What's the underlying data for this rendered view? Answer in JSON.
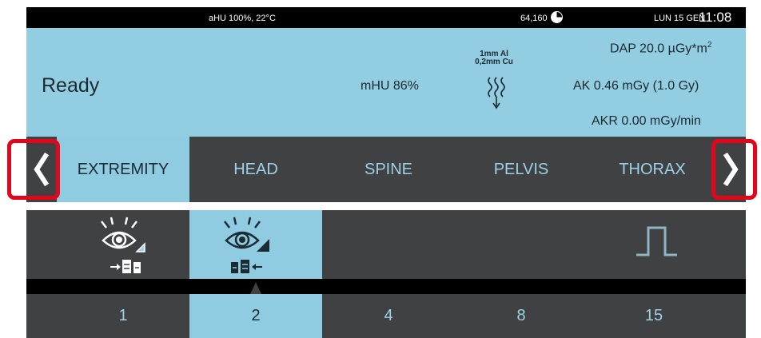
{
  "status_bar": {
    "environment": "aHU 100%, 22°C",
    "counter": "64,160",
    "date": "LUN 15 GEN",
    "time": "11:08"
  },
  "exposure_panel": {
    "status": "Ready",
    "tube_heat": "mHU 86%",
    "filter_line1": "1mm Al",
    "filter_line2": "0,2mm Cu",
    "dap_text": "DAP 20.0 µGy*m",
    "dap_exponent": "2",
    "ak": "AK 0.46 mGy  (1.0 Gy)",
    "akr": "AKR  0.00 mGy/min"
  },
  "regions": {
    "items": [
      {
        "label": "EXTREMITY",
        "selected": true
      },
      {
        "label": "HEAD",
        "selected": false
      },
      {
        "label": "SPINE",
        "selected": false
      },
      {
        "label": "PELVIS",
        "selected": false
      },
      {
        "label": "THORAX",
        "selected": false
      }
    ],
    "prev_icon": "chevron-left-icon",
    "next_icon": "chevron-right-icon"
  },
  "modes": {
    "items": [
      {
        "icon": "eye-dose-left-icon",
        "selected": false
      },
      {
        "icon": "eye-dose-right-icon",
        "selected": true
      },
      {
        "icon": "empty",
        "selected": false
      },
      {
        "icon": "empty",
        "selected": false
      },
      {
        "icon": "pulse-icon",
        "selected": false
      }
    ]
  },
  "pulse_rates": {
    "items": [
      {
        "label": "1",
        "selected": false
      },
      {
        "label": "2",
        "selected": true
      },
      {
        "label": "4",
        "selected": false
      },
      {
        "label": "8",
        "selected": false
      },
      {
        "label": "15",
        "selected": false
      }
    ]
  },
  "colors": {
    "accent": "#8fcbe1",
    "panel_dark": "#3f4142",
    "highlight_outline": "#e3061b",
    "text_light_blue": "#9ed0e6"
  }
}
